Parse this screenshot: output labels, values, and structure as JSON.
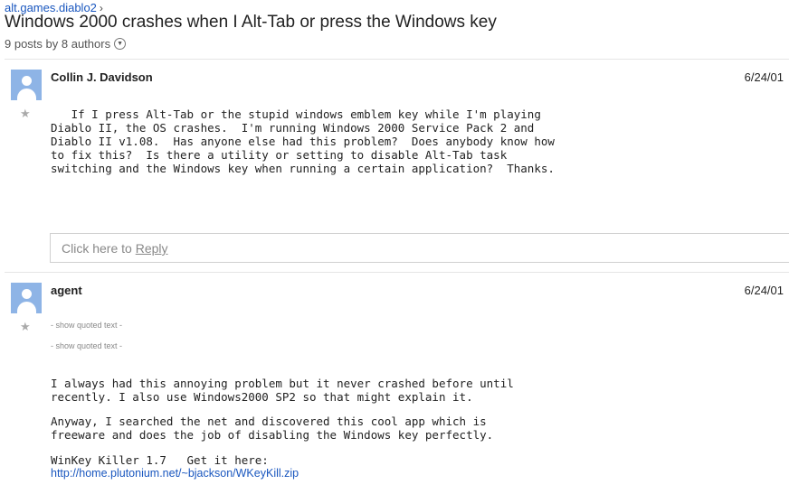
{
  "header": {
    "breadcrumb": "alt.games.diablo2",
    "breadcrumb_sep": "›",
    "title": "Windows 2000 crashes when I Alt-Tab or press the Windows key",
    "meta": "9 posts by 8 authors"
  },
  "posts": [
    {
      "author": "Collin J. Davidson",
      "date": "6/24/01",
      "body": "   If I press Alt-Tab or the stupid windows emblem key while I'm playing\nDiablo II, the OS crashes.  I'm running Windows 2000 Service Pack 2 and\nDiablo II v1.08.  Has anyone else had this problem?  Does anybody know how\nto fix this?  Is there a utility or setting to disable Alt-Tab task\nswitching and the Windows key when running a certain application?  Thanks.",
      "reply_prefix": "Click here to ",
      "reply_link": "Reply"
    },
    {
      "author": "agent",
      "date": "6/24/01",
      "quoted_1": "- show quoted text -",
      "quoted_2": "- show quoted text -",
      "para1": "I always had this annoying problem but it never crashed before until\nrecently. I also use Windows2000 SP2 so that might explain it.",
      "para2": "Anyway, I searched the net and discovered this cool app which is\nfreeware and does the job of disabling the Windows key perfectly.",
      "para3": "WinKey Killer 1.7   Get it here:",
      "link": "http://home.plutonium.net/~bjackson/WKeyKill.zip"
    }
  ],
  "icons": {
    "star": "star-icon",
    "avatar": "person-icon",
    "expand": "chevron-down-icon"
  },
  "colors": {
    "link": "#1a57bf",
    "avatar": "#8eb4e6"
  }
}
